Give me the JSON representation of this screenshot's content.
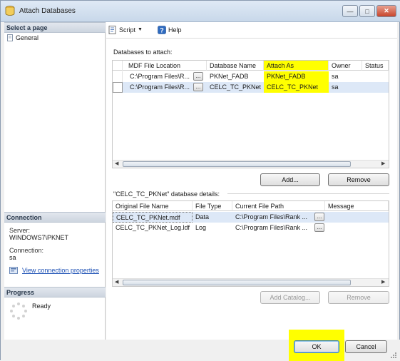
{
  "window": {
    "title": "Attach Databases"
  },
  "left": {
    "select_page": "Select a page",
    "pages": [
      "General"
    ],
    "connection": {
      "header": "Connection",
      "server_label": "Server:",
      "server_value": "WINDOWS7\\PKNET",
      "connection_label": "Connection:",
      "connection_value": "sa",
      "view_props": "View connection properties"
    },
    "progress": {
      "header": "Progress",
      "status": "Ready"
    }
  },
  "toolbar": {
    "script": "Script",
    "help": "Help"
  },
  "attach": {
    "label": "Databases to attach:",
    "columns": [
      "MDF File Location",
      "Database Name",
      "Attach As",
      "Owner",
      "Status"
    ],
    "rows": [
      {
        "location": "C:\\Program Files\\R...",
        "name": "PKNet_FADB",
        "attach_as": "PKNet_FADB",
        "owner": "sa",
        "status": ""
      },
      {
        "location": "C:\\Program Files\\R...",
        "name": "CELC_TC_PKNet",
        "attach_as": "CELC_TC_PKNet",
        "owner": "sa",
        "status": ""
      }
    ],
    "ellipsis": "...",
    "add": "Add...",
    "remove": "Remove"
  },
  "details": {
    "label": "\"CELC_TC_PKNet\" database details:",
    "columns": [
      "Original File Name",
      "File Type",
      "Current File Path",
      "Message"
    ],
    "rows": [
      {
        "file": "CELC_TC_PKNet.mdf",
        "type": "Data",
        "path": "C:\\Program Files\\Rank ...",
        "message": ""
      },
      {
        "file": "CELC_TC_PKNet_Log.ldf",
        "type": "Log",
        "path": "C:\\Program Files\\Rank ...",
        "message": ""
      }
    ],
    "add_catalog": "Add Catalog...",
    "remove": "Remove"
  },
  "footer": {
    "ok": "OK",
    "cancel": "Cancel"
  },
  "colors": {
    "highlight": "#ffff00",
    "selected_row": "#dde8f7",
    "link": "#1b4fb4"
  }
}
